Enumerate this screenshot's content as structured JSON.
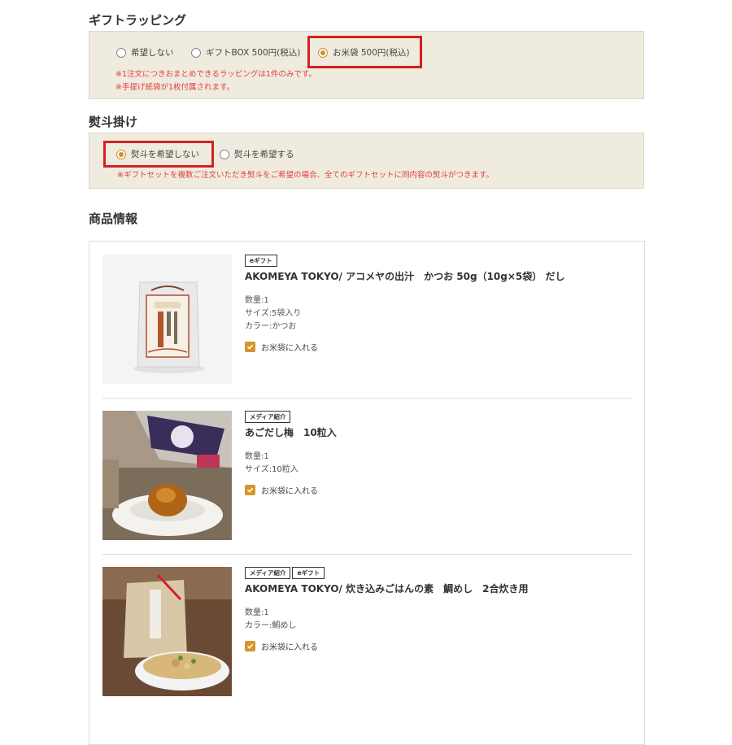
{
  "gift_wrapping": {
    "title": "ギフトラッピング",
    "options": [
      {
        "label": "希望しない",
        "selected": false
      },
      {
        "label": "ギフトBOX 500円(税込)",
        "selected": false
      },
      {
        "label": "お米袋 500円(税込)",
        "selected": true
      }
    ],
    "notes": [
      "※1注文につきおまとめできるラッピングは1件のみです。",
      "※手提げ紙袋が1枚付属されます。"
    ]
  },
  "noshi": {
    "title": "熨斗掛け",
    "options": [
      {
        "label": "熨斗を希望しない",
        "selected": true
      },
      {
        "label": "熨斗を希望する",
        "selected": false
      }
    ],
    "note": "※ギフトセットを複数ご注文いただき熨斗をご希望の場合、全てのギフトセットに同内容の熨斗がつきます。"
  },
  "products": {
    "title": "商品情報",
    "items": [
      {
        "badges": [
          "eギフト"
        ],
        "name": "AKOMEYA TOKYO/ アコメヤの出汁　かつお 50g（10g×5袋）  だし",
        "specs": [
          "数量:1",
          "サイズ:5袋入り",
          "カラー:かつお"
        ],
        "checkbox_label": "お米袋に入れる",
        "checked": true
      },
      {
        "badges": [
          "メディア紹介"
        ],
        "name": "あごだし梅　10粒入",
        "specs": [
          "数量:1",
          "サイズ:10粒入"
        ],
        "checkbox_label": "お米袋に入れる",
        "checked": true
      },
      {
        "badges": [
          "メディア紹介",
          "eギフト"
        ],
        "name": "AKOMEYA TOKYO/ 炊き込みごはんの素　鯛めし　2合炊き用",
        "specs": [
          "数量:1",
          "カラー:鯛めし"
        ],
        "checkbox_label": "お米袋に入れる",
        "checked": true
      }
    ]
  },
  "colors": {
    "accent": "#d0902a",
    "highlight": "#d42020",
    "note_text": "#e23c3c",
    "box_bg": "#efebdf"
  }
}
